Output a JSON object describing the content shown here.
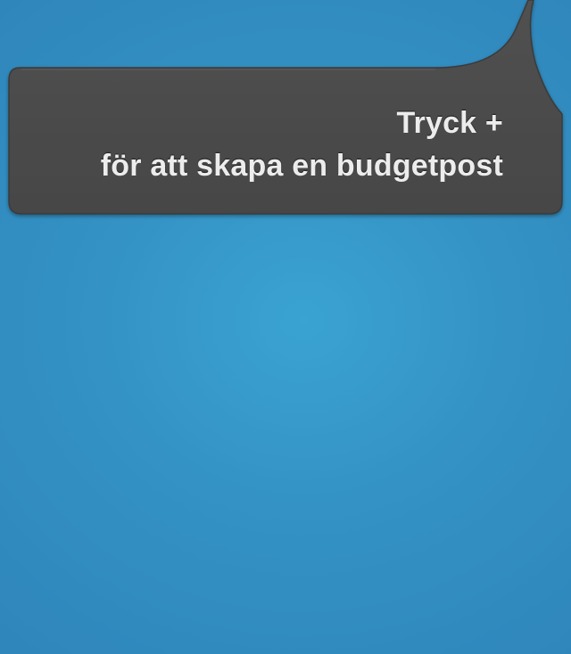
{
  "hint": {
    "line1": "Tryck +",
    "line2": "för att skapa en budgetpost"
  },
  "colors": {
    "background": "#3492c4",
    "bubble": "#4a4a4a",
    "text": "#ececec"
  },
  "icons": {
    "pointer": "speech-bubble-pointer"
  }
}
